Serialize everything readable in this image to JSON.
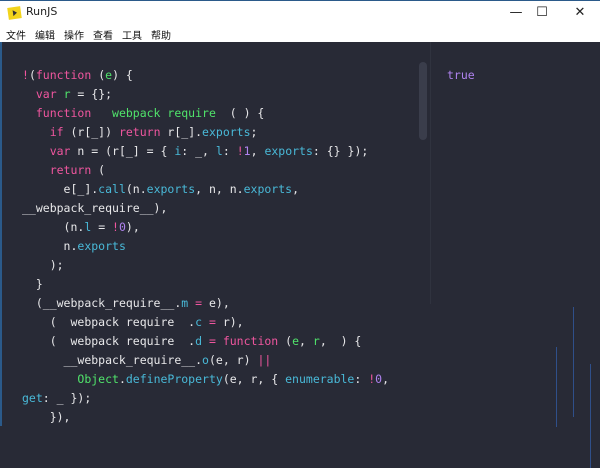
{
  "window": {
    "title": "RunJS",
    "minimize": "—",
    "maximize": "☐",
    "close": "✕",
    "accent": "#f2d41c"
  },
  "menu": [
    "文件",
    "编辑",
    "操作",
    "查看",
    "工具",
    "帮助"
  ],
  "editor": {
    "lines": [
      {
        "indent": 0,
        "tokens": [
          [
            "!",
            "k"
          ],
          [
            "(",
            "t"
          ],
          [
            "function",
            "k"
          ],
          [
            " (",
            "t"
          ],
          [
            "e",
            "f"
          ],
          [
            ") {",
            "t"
          ]
        ]
      },
      {
        "indent": 2,
        "tokens": [
          [
            "var",
            "k"
          ],
          [
            " r",
            "f"
          ],
          [
            " = {};",
            "t"
          ]
        ]
      },
      {
        "indent": 2,
        "tokens": [
          [
            "function",
            "k"
          ],
          [
            "   webpack require",
            "f"
          ],
          [
            "  ( ) {",
            "t"
          ]
        ]
      },
      {
        "indent": 4,
        "tokens": [
          [
            "if",
            "k"
          ],
          [
            " (r[_]) ",
            "t"
          ],
          [
            "return",
            "k"
          ],
          [
            " r[_].",
            "t"
          ],
          [
            "exports",
            "p"
          ],
          [
            ";",
            "t"
          ]
        ]
      },
      {
        "indent": 4,
        "tokens": [
          [
            "var",
            "k"
          ],
          [
            " n = (r[_] = { ",
            "t"
          ],
          [
            "i",
            "p"
          ],
          [
            ": _, ",
            "t"
          ],
          [
            "l",
            "p"
          ],
          [
            ": ",
            "t"
          ],
          [
            "!",
            "k"
          ],
          [
            "1",
            "n"
          ],
          [
            ", ",
            "t"
          ],
          [
            "exports",
            "p"
          ],
          [
            ": {} });",
            "t"
          ]
        ]
      },
      {
        "indent": 4,
        "tokens": [
          [
            "return",
            "k"
          ],
          [
            " (",
            "t"
          ]
        ]
      },
      {
        "indent": 6,
        "tokens": [
          [
            "e[_].",
            "t"
          ],
          [
            "call",
            "p"
          ],
          [
            "(n.",
            "t"
          ],
          [
            "exports",
            "p"
          ],
          [
            ", n, n.",
            "t"
          ],
          [
            "exports",
            "p"
          ],
          [
            ",",
            "t"
          ]
        ]
      },
      {
        "indent": 0,
        "tokens": [
          [
            "__webpack_require__),",
            "t"
          ]
        ]
      },
      {
        "indent": 6,
        "tokens": [
          [
            "(n.",
            "t"
          ],
          [
            "l",
            "p"
          ],
          [
            " = ",
            "t"
          ],
          [
            "!",
            "k"
          ],
          [
            "0",
            "n"
          ],
          [
            "),",
            "t"
          ]
        ]
      },
      {
        "indent": 6,
        "tokens": [
          [
            "n.",
            "t"
          ],
          [
            "exports",
            "p"
          ]
        ]
      },
      {
        "indent": 4,
        "tokens": [
          [
            ");",
            "t"
          ]
        ]
      },
      {
        "indent": 2,
        "tokens": [
          [
            "}",
            "t"
          ]
        ]
      },
      {
        "indent": 2,
        "tokens": [
          [
            "(__webpack_require__.",
            "t"
          ],
          [
            "m",
            "p"
          ],
          [
            " = ",
            "k"
          ],
          [
            "e),",
            "t"
          ]
        ]
      },
      {
        "indent": 4,
        "tokens": [
          [
            "(  webpack require  .",
            "t"
          ],
          [
            "c",
            "p"
          ],
          [
            " = ",
            "k"
          ],
          [
            "r),",
            "t"
          ]
        ]
      },
      {
        "indent": 4,
        "tokens": [
          [
            "(  webpack require  .",
            "t"
          ],
          [
            "d",
            "p"
          ],
          [
            " = ",
            "k"
          ],
          [
            "function",
            "k"
          ],
          [
            " (",
            "t"
          ],
          [
            "e",
            "f"
          ],
          [
            ", ",
            "t"
          ],
          [
            "r",
            "f"
          ],
          [
            ",  ) {",
            "t"
          ]
        ]
      },
      {
        "indent": 6,
        "tokens": [
          [
            "__webpack_require__.",
            "t"
          ],
          [
            "o",
            "p"
          ],
          [
            "(e, r) ",
            "t"
          ],
          [
            "||",
            "k"
          ]
        ]
      },
      {
        "indent": 8,
        "tokens": [
          [
            "Object",
            "f"
          ],
          [
            ".",
            "t"
          ],
          [
            "defineProperty",
            "p"
          ],
          [
            "(e, r, { ",
            "t"
          ],
          [
            "enumerable",
            "p"
          ],
          [
            ": ",
            "t"
          ],
          [
            "!",
            "k"
          ],
          [
            "0",
            "n"
          ],
          [
            ",",
            "t"
          ]
        ]
      },
      {
        "indent": 0,
        "tokens": [
          [
            "get",
            "p"
          ],
          [
            ": _ });",
            "t"
          ]
        ]
      },
      {
        "indent": 4,
        "tokens": [
          [
            "}),",
            "t"
          ]
        ]
      }
    ]
  },
  "output": {
    "lines": [
      "true"
    ]
  }
}
